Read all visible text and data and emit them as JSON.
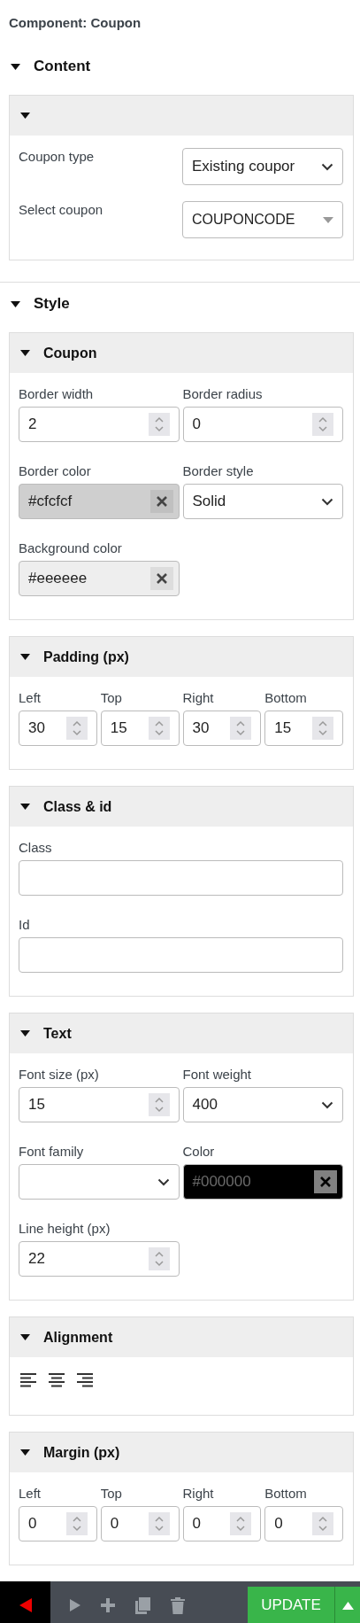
{
  "title": "Component: Coupon",
  "sections": [
    {
      "title": "Content",
      "expanded": true,
      "panels": [
        {
          "expanded": true,
          "kind": "rows",
          "fields": [
            {
              "label": "Coupon type",
              "kind": "select",
              "value": "Existing coupor"
            },
            {
              "label": "Select coupon",
              "kind": "combo",
              "value": "COUPONCODE"
            }
          ]
        }
      ]
    },
    {
      "title": "Style",
      "expanded": true,
      "panels": [
        {
          "title": "Coupon",
          "expanded": true,
          "kind": "two",
          "fields": [
            {
              "label": "Border width",
              "kind": "number",
              "value": "2"
            },
            {
              "label": "Border radius",
              "kind": "number",
              "value": "0"
            },
            {
              "label": "Border color",
              "kind": "color",
              "value": "#cfcfcf",
              "color": "#cfcfcf"
            },
            {
              "label": "Border style",
              "kind": "select",
              "value": "Solid"
            },
            {
              "label": "Background color",
              "kind": "color",
              "value": "#eeeeee",
              "color": "#eeeeee"
            }
          ]
        },
        {
          "title": "Padding (px)",
          "expanded": true,
          "kind": "four",
          "fields": [
            {
              "label": "Left",
              "kind": "number",
              "value": "30"
            },
            {
              "label": "Top",
              "kind": "number",
              "value": "15"
            },
            {
              "label": "Right",
              "kind": "number",
              "value": "30"
            },
            {
              "label": "Bottom",
              "kind": "number",
              "value": "15"
            }
          ]
        },
        {
          "title": "Class & id",
          "expanded": true,
          "kind": "one",
          "fields": [
            {
              "label": "Class",
              "kind": "text"
            },
            {
              "label": "Id",
              "kind": "text"
            }
          ]
        },
        {
          "title": "Text",
          "expanded": true,
          "kind": "two",
          "fields": [
            {
              "label": "Font size (px)",
              "kind": "number",
              "value": "15"
            },
            {
              "label": "Font weight",
              "kind": "select",
              "value": "400"
            },
            {
              "label": "Font family",
              "kind": "select"
            },
            {
              "label": "Color",
              "kind": "color",
              "value": "#000000",
              "color": "#000000"
            },
            {
              "label": "Line height (px)",
              "kind": "number",
              "value": "22"
            }
          ]
        },
        {
          "title": "Alignment",
          "expanded": true,
          "kind": "align",
          "fields": [
            {
              "kind": "align-left"
            },
            {
              "kind": "align-center"
            },
            {
              "kind": "align-right"
            }
          ]
        },
        {
          "title": "Margin (px)",
          "expanded": true,
          "kind": "four",
          "fields": [
            {
              "label": "Left",
              "kind": "number",
              "value": "0"
            },
            {
              "label": "Top",
              "kind": "number",
              "value": "0"
            },
            {
              "label": "Right",
              "kind": "number",
              "value": "0"
            },
            {
              "label": "Bottom",
              "kind": "number",
              "value": "0"
            }
          ]
        }
      ]
    }
  ],
  "toolbar": {
    "buttons": [
      {
        "kind": "back"
      },
      {
        "kind": "forward"
      },
      {
        "kind": "add"
      },
      {
        "kind": "copy"
      },
      {
        "kind": "delete"
      }
    ],
    "update": {
      "label": "UPDATE"
    },
    "menu": {
      "kind": "caret-up"
    }
  }
}
